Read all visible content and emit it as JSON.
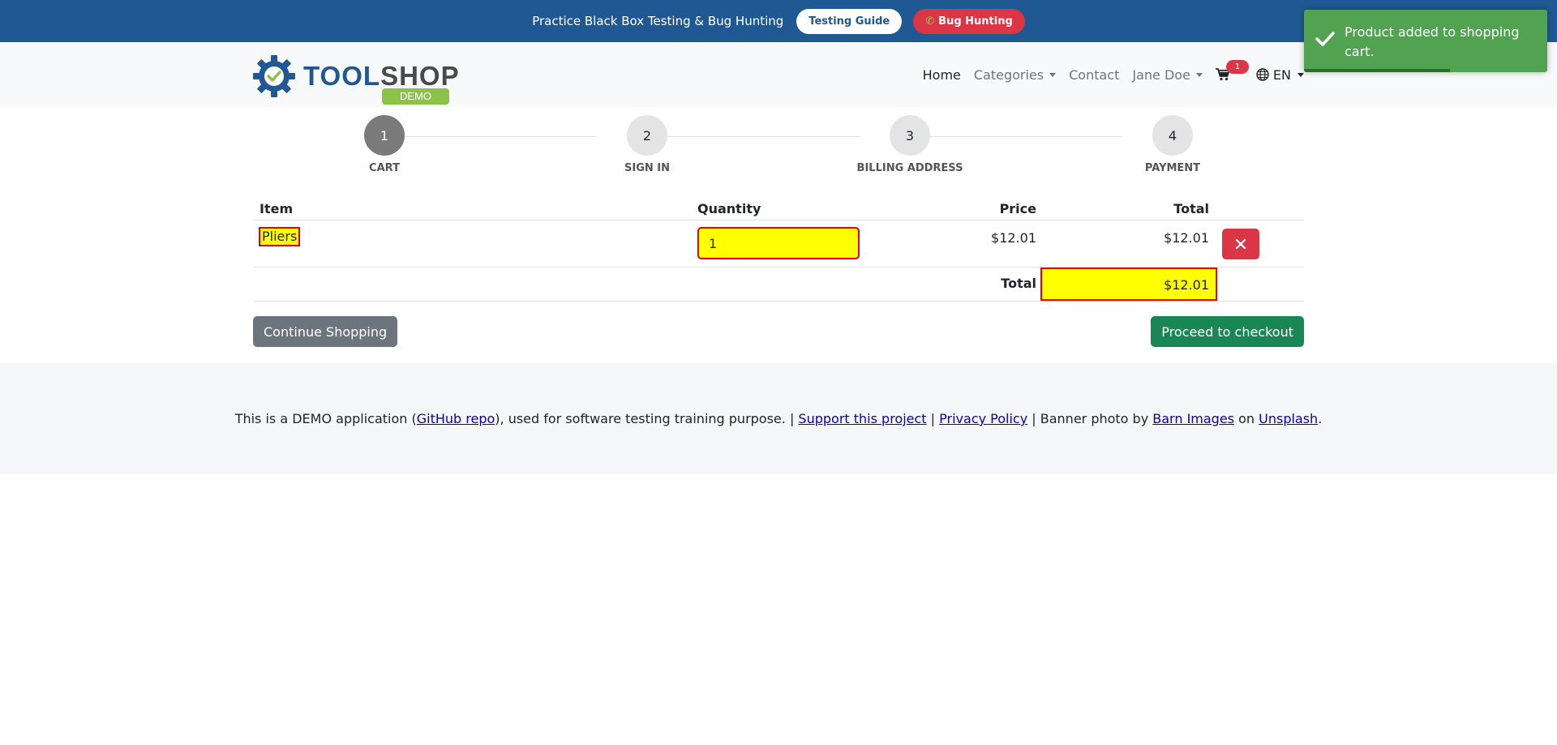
{
  "banner": {
    "text": "Practice Black Box Testing & Bug Hunting",
    "testing_guide": "Testing Guide",
    "bug_hunting": "Bug Hunting"
  },
  "logo": {
    "part1": "TOOL",
    "part2": "SHOP",
    "badge": "DEMO"
  },
  "nav": {
    "home": "Home",
    "categories": "Categories",
    "contact": "Contact",
    "user": "Jane Doe",
    "cart_count": "1",
    "language": "EN"
  },
  "steps": [
    {
      "number": "1",
      "label": "CART",
      "active": true
    },
    {
      "number": "2",
      "label": "SIGN IN",
      "active": false
    },
    {
      "number": "3",
      "label": "BILLING ADDRESS",
      "active": false
    },
    {
      "number": "4",
      "label": "PAYMENT",
      "active": false
    }
  ],
  "table": {
    "headers": {
      "item": "Item",
      "quantity": "Quantity",
      "price": "Price",
      "total": "Total"
    },
    "rows": [
      {
        "item": "Pliers",
        "quantity": "1",
        "price": "$12.01",
        "total": "$12.01"
      }
    ],
    "total_label": "Total",
    "total_value": "$12.01"
  },
  "buttons": {
    "continue": "Continue Shopping",
    "checkout": "Proceed to checkout"
  },
  "footer": {
    "t1": "This is a DEMO application (",
    "github": "GitHub repo",
    "t2": "), used for software testing training purpose. | ",
    "support": "Support this project",
    "t3": " | ",
    "privacy": "Privacy Policy",
    "t4": " | Banner photo by ",
    "barn": "Barn Images",
    "t5": " on ",
    "unsplash": "Unsplash",
    "t6": "."
  },
  "toast": {
    "message": "Product added to shopping cart.",
    "progress": 0.6
  },
  "colors": {
    "banner": "#1f5893",
    "danger": "#dc3545",
    "success": "#198754",
    "toast": "#51a351",
    "highlight": "#ffff00"
  }
}
